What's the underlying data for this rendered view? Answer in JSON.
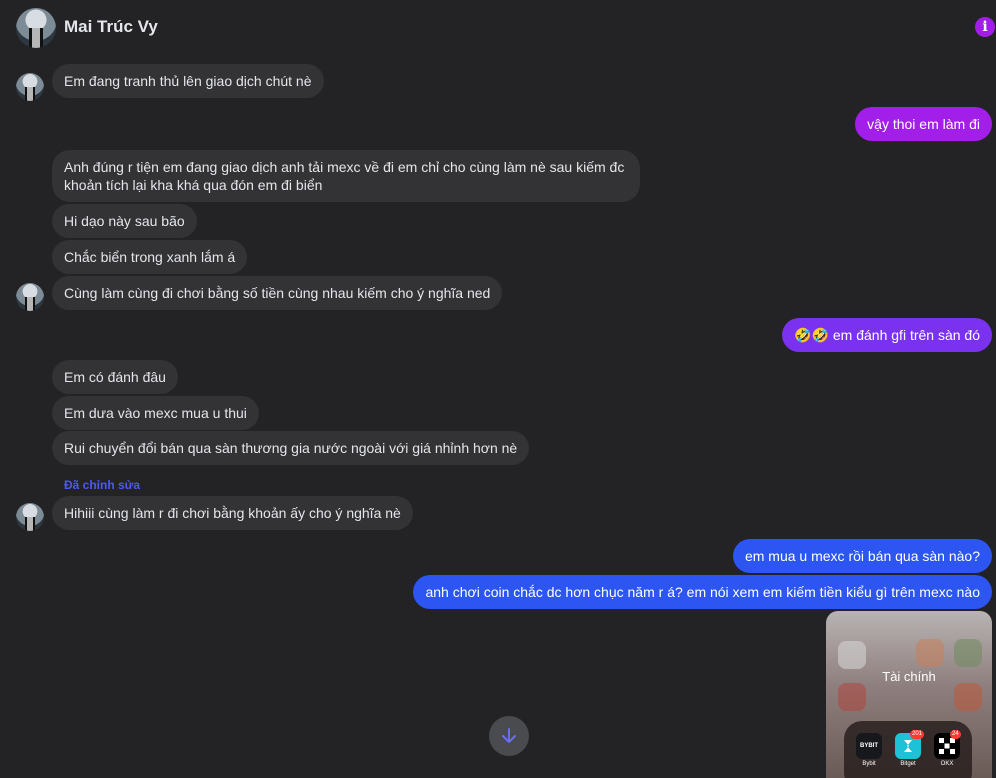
{
  "header": {
    "contact_name": "Mai Trúc Vy"
  },
  "messages": {
    "m1": "Em đang tranh thủ lên giao dịch chút nè",
    "m2": "vậy thoi em làm đi",
    "m3": "Anh đúng r tiện em đang giao dịch anh tải mexc về đi em chỉ cho cùng làm nè sau kiếm đc khoản tích lại kha khá qua đón em đi biển",
    "m4": "Hi dạo này sau bão",
    "m5": "Chắc biển trong xanh lắm á",
    "m6": "Cùng làm cùng đi chơi bằng số tiền cùng nhau kiếm cho ý nghĩa ned",
    "m7_emoji": "🤣🤣",
    "m7": " em đánh gfi trên sàn đó",
    "m8": "Em có đánh đâu",
    "m9": "Em dưa vào mexc mua u thui",
    "m10": "Rui chuyển đổi bán qua sàn thương gia nước ngoài với giá nhỉnh hơn nè",
    "edited_label": "Đã chỉnh sửa",
    "m11": "Hihiii cùng làm r đi chơi bằng khoản ấy cho ý nghĩa nè",
    "m12": "em mua u mexc rồi bán qua sàn nào?",
    "m13": "anh chơi coin chắc dc hơn chục năm r á? em nói xem em kiếm tiền kiểu gì trên mexc nào"
  },
  "photo": {
    "folder_label": "Tài chính",
    "apps": [
      {
        "tile": "BYBIT",
        "label": "Bybit",
        "badge": ""
      },
      {
        "tile": "",
        "label": "Bitget",
        "badge": "201"
      },
      {
        "tile": "",
        "label": "OKX",
        "badge": "24"
      }
    ]
  },
  "colors": {
    "background": "#232325",
    "incoming_bubble": "#333335",
    "outgoing_purple": "#a11fe9",
    "outgoing_violet": "#7a31f0",
    "outgoing_blue": "#2c55f2",
    "edited_label": "#4c59f2",
    "info_icon": "#a21ee8"
  },
  "icons": {
    "info": "info-icon",
    "scroll_down": "arrow-down-icon"
  }
}
